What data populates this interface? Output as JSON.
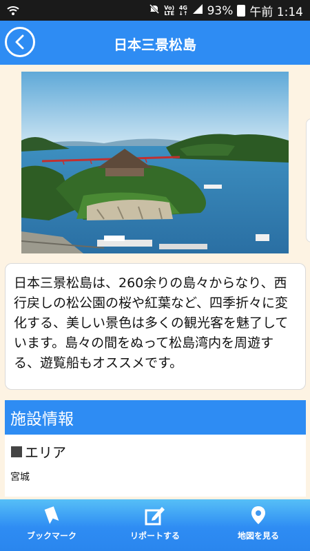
{
  "status_bar": {
    "volte_top": "Vo)",
    "volte_bottom": "LTE",
    "network_top": "4G",
    "network_bottom": "↓↑",
    "battery": "93%",
    "time": "午前 1:14"
  },
  "header": {
    "title": "日本三景松島"
  },
  "description": "日本三景松島は、260余りの島々からなり、西行戻しの松公園の桜や紅葉など、四季折々に変化する、美しい景色は多くの観光客を魅了しています。島々の間をぬって松島湾内を周遊する、遊覧船もオススメです。",
  "facility": {
    "header": "施設情報",
    "area_label": "エリア",
    "area_value": "宮城"
  },
  "bottom_nav": [
    {
      "label": "ブックマーク",
      "icon": "bookmark-icon"
    },
    {
      "label": "リポートする",
      "icon": "report-icon"
    },
    {
      "label": "地図を見る",
      "icon": "map-pin-icon"
    }
  ],
  "colors": {
    "accent": "#2e8cf3",
    "background": "#fdf3e3"
  }
}
